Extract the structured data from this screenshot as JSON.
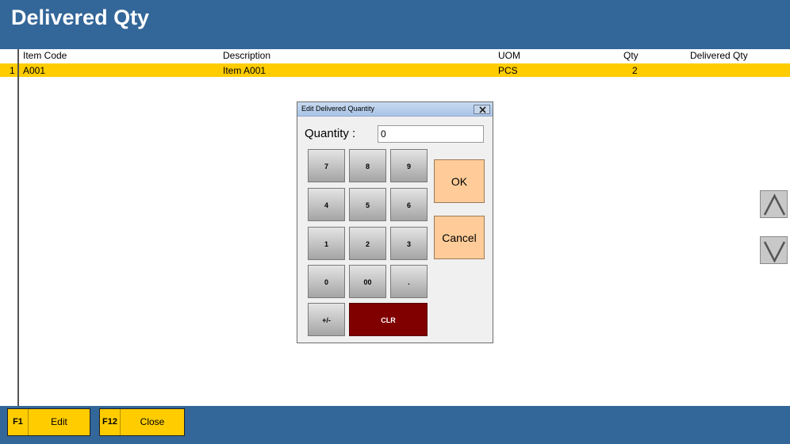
{
  "header": {
    "title": "Delivered Qty"
  },
  "grid": {
    "columns": {
      "item_code": "Item Code",
      "description": "Description",
      "uom": "UOM",
      "qty": "Qty",
      "delivered_qty": "Delivered Qty"
    },
    "rows": [
      {
        "num": "1",
        "item_code": "A001",
        "description": "Item A001",
        "uom": "PCS",
        "qty": "2",
        "delivered_qty": ""
      }
    ]
  },
  "dialog": {
    "title": "Edit Delivered Quantity",
    "quantity_label": "Quantity :",
    "quantity_value": "0",
    "keys": {
      "k7": "7",
      "k8": "8",
      "k9": "9",
      "k4": "4",
      "k5": "5",
      "k6": "6",
      "k1": "1",
      "k2": "2",
      "k3": "3",
      "k0": "0",
      "k00": "00",
      "kdot": ".",
      "kneg": "+/-",
      "clr": "CLR"
    },
    "ok_label": "OK",
    "cancel_label": "Cancel"
  },
  "footer": {
    "f1_key": "F1",
    "f1_label": "Edit",
    "f12_key": "F12",
    "f12_label": "Close"
  },
  "colors": {
    "header_bg": "#336699",
    "row_highlight": "#ffcc00",
    "action_button": "#ffcc99",
    "clr_button": "#800000"
  },
  "icons": {
    "scroll_up": "chevron-up-icon",
    "scroll_down": "chevron-down-icon",
    "dialog_close": "close-icon"
  }
}
